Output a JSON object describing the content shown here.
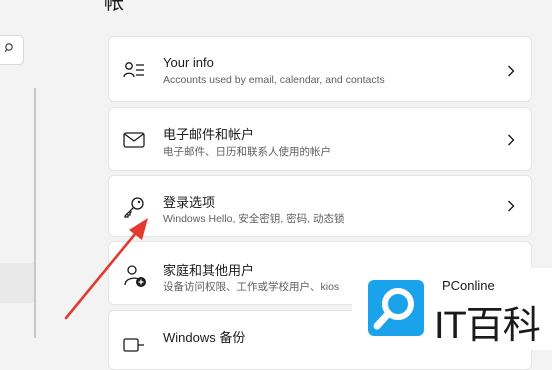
{
  "header": {
    "partial_title": "帐"
  },
  "cards": [
    {
      "title": "Your info",
      "subtitle": "Accounts used by email, calendar, and contacts",
      "icon": "person-list-icon"
    },
    {
      "title": "电子邮件和帐户",
      "subtitle": "电子邮件、日历和联系人使用的帐户",
      "icon": "mail-icon"
    },
    {
      "title": "登录选项",
      "subtitle": "Windows Hello, 安全密钥, 密码, 动态锁",
      "icon": "key-icon"
    },
    {
      "title": "家庭和其他用户",
      "subtitle": "设备访问权限、工作或学校用户、kios",
      "icon": "person-add-icon"
    },
    {
      "title": "Windows 备份",
      "icon": "backup-icon"
    }
  ],
  "watermark": {
    "brand_small": "PConline",
    "brand_large": "IT百科",
    "brand_color": "#1aa3ea"
  },
  "annotation": {
    "arrow_color": "#e23b2e"
  }
}
